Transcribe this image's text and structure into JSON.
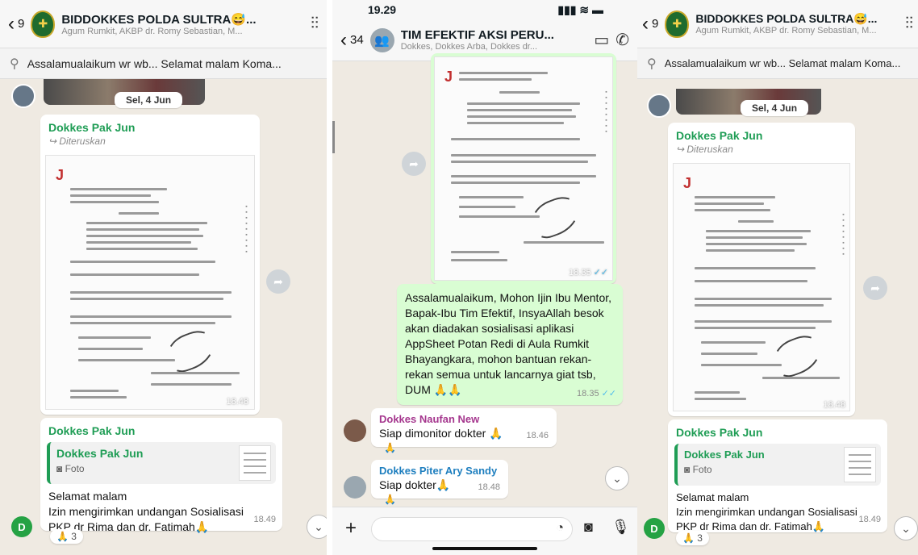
{
  "left": {
    "back_count": "9",
    "chat_title": "BIDDOKKES POLDA SULTRA😅...",
    "chat_subtitle": "Agum Rumkit, AKBP dr. Romy Sebastian, M...",
    "pinned_text": "Assalamualaikum wr wb... Selamat malam Koma...",
    "date_label": "Sel, 4 Jun",
    "msg1_sender": "Dokkes Pak Jun",
    "msg1_forwarded": "Diteruskan",
    "msg1_time": "18.48",
    "msg2_sender": "Dokkes Pak Jun",
    "msg2_quote_name": "Dokkes Pak Jun",
    "msg2_quote_type": "Foto",
    "msg2_line1": "Selamat malam",
    "msg2_line2": "Izin mengirimkan undangan Sosialisasi",
    "msg2_line3": "PKP dr Rima dan dr. Fatimah🙏",
    "msg2_time": "18.49",
    "msg2_reaction": "🙏 3",
    "avatar_letter": "D"
  },
  "middle": {
    "status_time": "19.29",
    "status_icons": "▮▮▮ ≋ ▬",
    "back_count": "34",
    "chat_title": "TIM EFEKTIF AKSI PERU...",
    "chat_subtitle": "Dokkes, Dokkes Arba, Dokkes dr...",
    "img_time": "18.35",
    "out_text": "Assalamualaikum, Mohon Ijin Ibu Mentor, Bapak-Ibu Tim Efektif, InsyaAllah besok akan diadakan sosialisasi aplikasi AppSheet Potan Redi di Aula Rumkit Bhayangkara, mohon bantuan rekan-rekan semua untuk lancarnya giat tsb, DUM 🙏🙏",
    "out_time": "18.35",
    "m1_sender": "Dokkes Naufan New",
    "m1_text": "Siap dimonitor dokter 🙏",
    "m1_time": "18.46",
    "m1_reaction": "🙏",
    "m2_sender": "Dokkes Piter Ary Sandy",
    "m2_text": "Siap dokter🙏",
    "m2_time": "18.48",
    "m2_reaction": "🙏"
  },
  "right": {
    "back_count": "9",
    "chat_title": "BIDDOKKES POLDA SULTRA😅...",
    "chat_subtitle": "Agum Rumkit, AKBP dr. Romy Sebastian, M...",
    "pinned_text": "Assalamualaikum wr wb... Selamat malam Koma...",
    "date_label": "Sel, 4 Jun",
    "msg1_sender": "Dokkes Pak Jun",
    "msg1_forwarded": "Diteruskan",
    "msg1_time": "18.48",
    "msg2_sender": "Dokkes Pak Jun",
    "msg2_quote_name": "Dokkes Pak Jun",
    "msg2_quote_type": "Foto",
    "msg2_line1": "Selamat malam",
    "msg2_line2": "Izin mengirimkan undangan Sosialisasi",
    "msg2_line3": "PKP dr Rima dan dr. Fatimah🙏",
    "msg2_time": "18.49",
    "msg2_reaction": "🙏 3",
    "avatar_letter": "D"
  },
  "colors": {
    "accent_green": "#1f9d55",
    "outgoing_bubble": "#d9fdd3",
    "chat_bg": "#efeae2"
  }
}
